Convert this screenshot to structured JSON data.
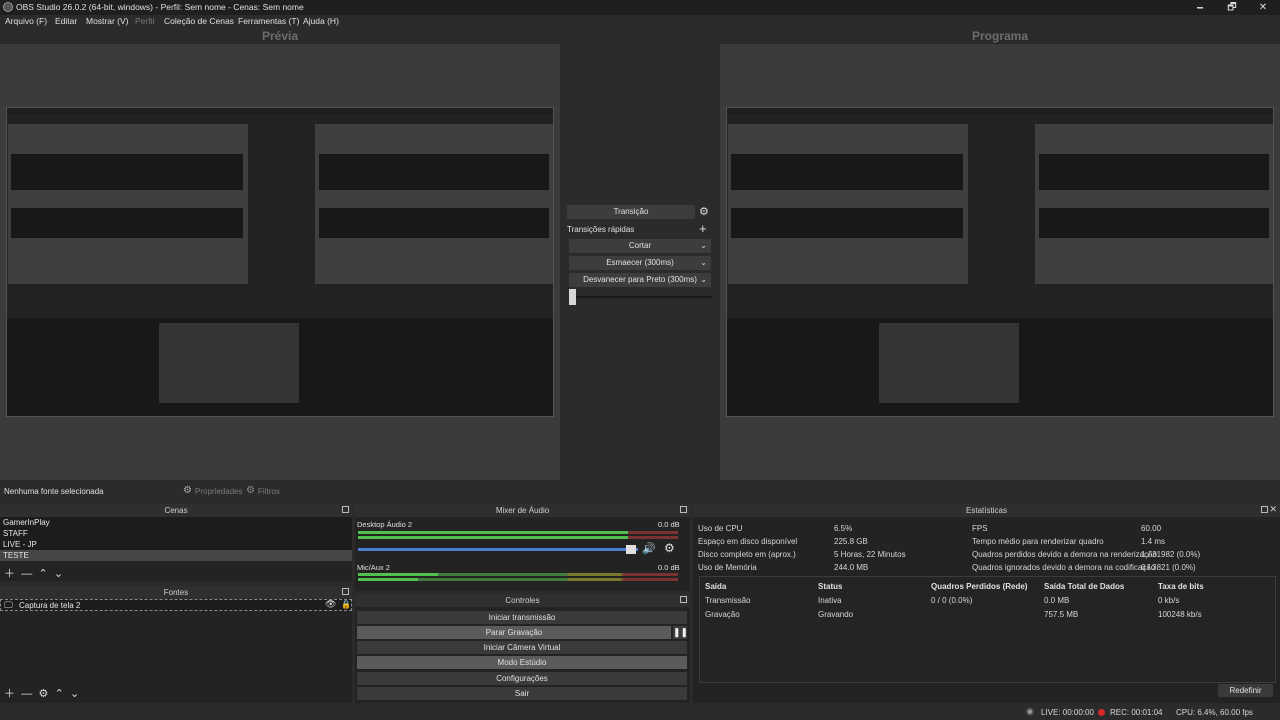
{
  "window": {
    "title": "OBS Studio 26.0.2 (64-bit, windows) - Perfil: Sem nome - Cenas: Sem nome",
    "minimize": "🗕",
    "maximize": "🗗",
    "close": "✕"
  },
  "menu": [
    "Arquivo (F)",
    "Editar",
    "Mostrar (V)",
    "Perfil",
    "Coleção de Cenas",
    "Ferramentas (T)",
    "Ajuda (H)"
  ],
  "preview_label": "Prévia",
  "program_label": "Programa",
  "transition_panel": {
    "transition_button": "Transição",
    "quick_transitions_label": "Transições rápidas",
    "items": [
      "Cortar",
      "Esmaecer (300ms)",
      "Desvanecer para Preto (300ms)"
    ],
    "slider_position": 0.0
  },
  "source_status": {
    "no_source": "Nenhuma fonte selecionada",
    "properties": "Propriedades",
    "filters": "Filtros"
  },
  "scenes": {
    "title": "Cenas",
    "items": [
      "GamerInPlay",
      "STAFF",
      "LIVE - JP",
      "TESTE"
    ]
  },
  "sources": {
    "title": "Fontes",
    "items": [
      {
        "name": "Captura de tela 2",
        "icon": "monitor-icon"
      }
    ]
  },
  "mixer": {
    "title": "Mixer de Áudio",
    "channels": [
      {
        "name": "Desktop Áudio 2",
        "db": "0.0 dB",
        "volume": 0.93
      },
      {
        "name": "Mic/Aux 2",
        "db": "0.0 dB",
        "volume": 0.93
      }
    ]
  },
  "controls": {
    "title": "Controles",
    "buttons": [
      "Iniciar transmissão",
      "Parar Gravação",
      "Iniciar Câmera Virtual",
      "Modo Estúdio",
      "Configurações",
      "Sair"
    ]
  },
  "stats": {
    "title": "Estatísticas",
    "left": [
      {
        "k": "Uso de CPU",
        "v": "6.5%"
      },
      {
        "k": "Espaço em disco disponível",
        "v": "225.8 GB"
      },
      {
        "k": "Disco completo em (aprox.)",
        "v": "5 Horas, 22 Minutos"
      },
      {
        "k": "Uso de Memória",
        "v": "244.0 MB"
      }
    ],
    "right": [
      {
        "k": "FPS",
        "v": "60.00"
      },
      {
        "k": "Tempo médio para renderizar quadro",
        "v": "1.4 ms"
      },
      {
        "k": "Quadros perdidos devido a demora na renderização",
        "v": "1 / 31982 (0.0%)"
      },
      {
        "k": "Quadros ignorados devido a demora na codificação",
        "v": "0 / 3821 (0.0%)"
      }
    ],
    "table_headers": [
      "Saída",
      "Status",
      "Quadros Perdidos (Rede)",
      "Saída Total de Dados",
      "Taxa de bits"
    ],
    "table_rows": [
      [
        "Transmissão",
        "Inativa",
        "0 / 0 (0.0%)",
        "0.0 MB",
        "0 kb/s"
      ],
      [
        "Gravação",
        "Gravando",
        "",
        "757.5 MB",
        "100248 kb/s"
      ]
    ],
    "reset": "Redefinir"
  },
  "statusbar": {
    "live": "LIVE: 00:00:00",
    "rec": "REC: 00:01:04",
    "cpu": "CPU: 6.4%, 60.00 fps"
  },
  "colors": {
    "rec_dot": "#d22a2a",
    "meter_green": "#4fc14f",
    "slider_blue": "#4a7fd0"
  }
}
